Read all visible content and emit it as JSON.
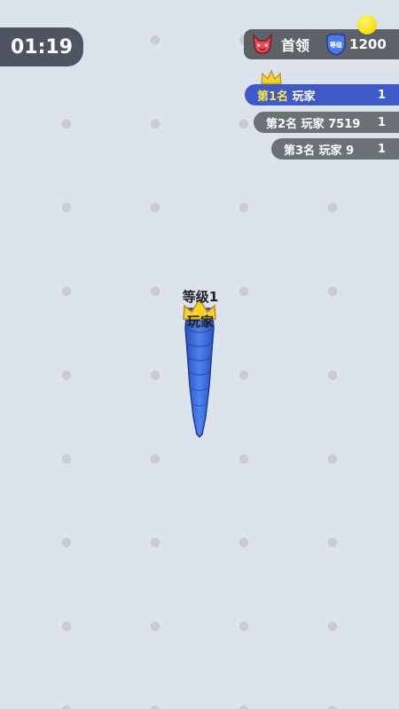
{
  "hud": {
    "timer": "01:19",
    "boss_label": "首领",
    "level_badge": "等级",
    "score": "1200"
  },
  "leaderboard": [
    {
      "rank": "第1名",
      "name": "玩家",
      "score": "1"
    },
    {
      "rank": "第2名",
      "name": "玩家 7519",
      "score": "1"
    },
    {
      "rank": "第3名",
      "name": "玩家 9",
      "score": "1"
    }
  ],
  "player": {
    "level_text": "等级1",
    "name": "玩家"
  },
  "colors": {
    "background": "#dde3ec",
    "snake": "#3b6bd6",
    "leader_row": "#3f59c9",
    "other_row": "#6c7178",
    "coin": "#fbe319"
  },
  "icons": [
    "devil-icon",
    "level-shield-icon",
    "coin-icon",
    "crown-icon"
  ]
}
